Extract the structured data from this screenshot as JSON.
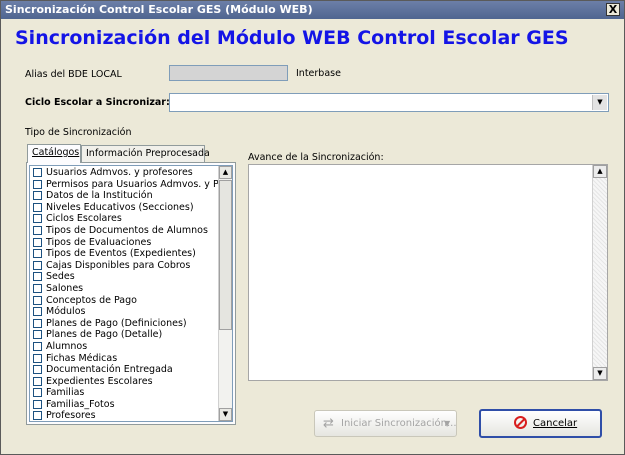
{
  "window": {
    "title": "Sincronización Control Escolar GES (Módulo WEB)",
    "close_glyph": "X"
  },
  "heading": "Sincronización del Módulo WEB Control Escolar GES",
  "alias": {
    "label": "Alias del BDE LOCAL",
    "value": "",
    "db_name": "Interbase"
  },
  "ciclo": {
    "label": "Ciclo Escolar a Sincronizar:",
    "value": ""
  },
  "tipo_label": "Tipo de Sincronización",
  "tabs": [
    "Catálogos",
    "Información Preprocesada"
  ],
  "catalog_items": [
    "Usuarios Admvos. y profesores",
    "Permisos para Usuarios Admvos. y Profrs",
    "Datos de la Institución",
    "Niveles Educativos (Secciones)",
    "Ciclos Escolares",
    "Tipos de Documentos de Alumnos",
    "Tipos de Evaluaciones",
    "Tipos de Eventos (Expedientes)",
    "Cajas Disponibles para Cobros",
    "Sedes",
    "Salones",
    "Conceptos de Pago",
    "Módulos",
    "Planes de Pago (Definiciones)",
    "Planes de Pago (Detalle)",
    "Alumnos",
    "Fichas Médicas",
    "Documentación Entregada",
    "Expedientes Escolares",
    "Familias",
    "Familias_Fotos",
    "Profesores"
  ],
  "avance_label": "Avance de la Sincronización:",
  "buttons": {
    "start": "Iniciar Sincronización...",
    "cancel": "Cancelar"
  },
  "icons": {
    "start": "sync-arrows-icon",
    "cancel": "cancel-circle-icon"
  },
  "colors": {
    "heading": "#1414e6",
    "titlebar": "#5b6f9a"
  }
}
